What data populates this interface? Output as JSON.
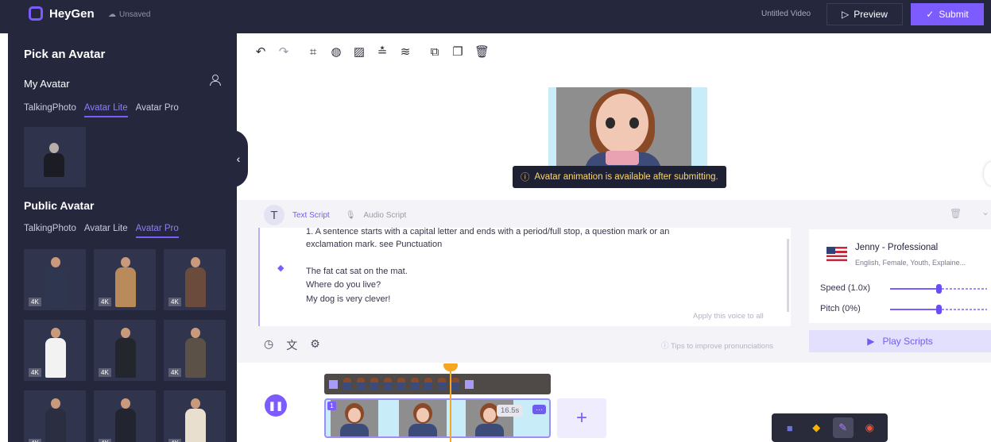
{
  "header": {
    "brand": "HeyGen",
    "status": "Unsaved",
    "video_title": "Untitled Video",
    "preview_label": "Preview",
    "submit_label": "Submit"
  },
  "sidebar": {
    "title": "Pick an Avatar",
    "my_avatar_label": "My Avatar",
    "my_tabs": [
      "TalkingPhoto",
      "Avatar Lite",
      "Avatar Pro"
    ],
    "my_active_tab": "Avatar Lite",
    "public_avatar_label": "Public Avatar",
    "public_tabs": [
      "TalkingPhoto",
      "Avatar Lite",
      "Avatar Pro"
    ],
    "public_active_tab": "Avatar Pro",
    "badge": "4K",
    "avatar_colors": [
      "#2e3650",
      "#b98a5a",
      "#6b4c3c",
      "#f2f2f2",
      "#24262e",
      "#5b5147",
      "#2a2e40",
      "#22252f",
      "#e8dfcf"
    ]
  },
  "toolbar": {
    "icons": [
      "undo-icon",
      "redo-icon",
      "crop-icon",
      "color-icon",
      "texture-icon",
      "align-icon",
      "layers-icon",
      "duplicate-icon",
      "copy-icon",
      "delete-icon"
    ]
  },
  "canvas": {
    "notice": "Avatar animation is available after submitting."
  },
  "script": {
    "tab_text": "Text Script",
    "tab_audio": "Audio Script",
    "lines": [
      "1. A sentence starts with a capital letter and ends with a period/full stop, a question mark or an",
      "exclamation mark. see Punctuation",
      "The fat cat sat on the mat.",
      "Where do you live?",
      "My dog is very clever!"
    ],
    "apply_label": "Apply this voice to all",
    "tips_label": "Tips to improve pronunciations"
  },
  "voice": {
    "name": "Jenny - Professional",
    "description": "English, Female, Youth, Explaine...",
    "speed_label": "Speed (1.0x)",
    "pitch_label": "Pitch (0%)",
    "speed_level": 0.5,
    "pitch_level": 0.5,
    "play_label": "Play Scripts"
  },
  "timeline": {
    "scene_number": "1",
    "duration": "16.5s",
    "more_label": "···",
    "add_label": "+"
  },
  "colors": {
    "accent": "#7c5cff",
    "dark_bg": "#25283d",
    "warning": "#ffc94d"
  }
}
